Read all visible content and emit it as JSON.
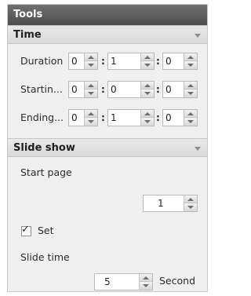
{
  "panel": {
    "title": "Tools"
  },
  "time_section": {
    "title": "Time",
    "rows": [
      {
        "label": "Duration",
        "values": [
          "0",
          "1",
          "0"
        ]
      },
      {
        "label": "Startin...",
        "values": [
          "0",
          "0",
          "0"
        ]
      },
      {
        "label": "Ending...",
        "values": [
          "0",
          "1",
          "0"
        ]
      }
    ],
    "separator": ":"
  },
  "slideshow_section": {
    "title": "Slide show",
    "start_page_label": "Start page",
    "start_page_value": "1",
    "set_label": "Set",
    "set_checked": true,
    "check_glyph": "✓",
    "slide_time_label": "Slide time",
    "slide_time_value": "5",
    "slide_time_unit": "Second"
  }
}
